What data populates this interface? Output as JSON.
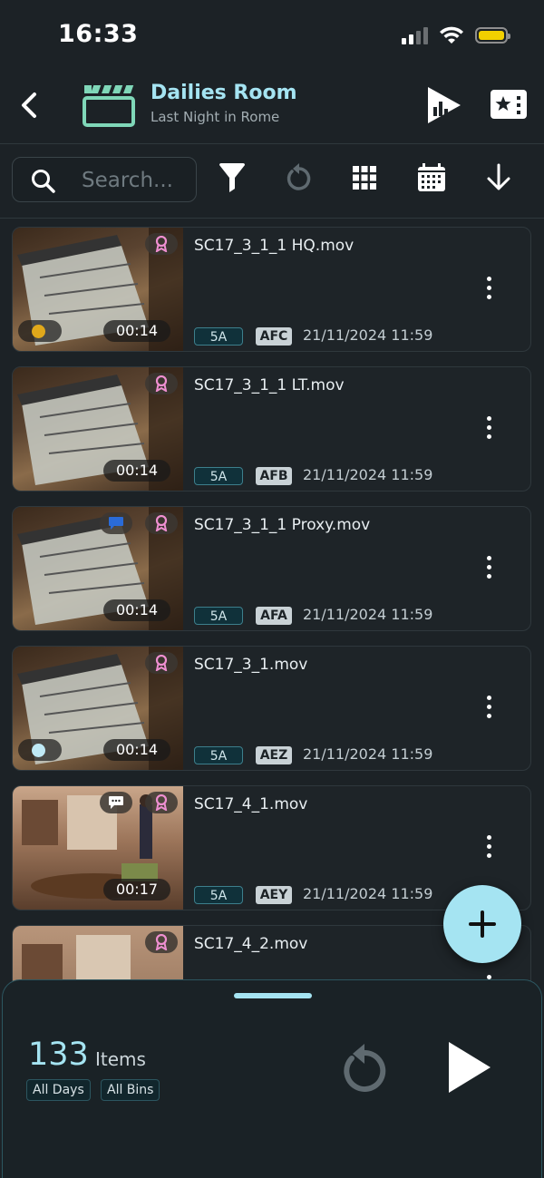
{
  "status_bar": {
    "time": "16:33"
  },
  "header": {
    "title": "Dailies Room",
    "subtitle": "Last Night in Rome"
  },
  "toolbar": {
    "search_placeholder": "Search...",
    "icons": [
      "search-icon",
      "filter-icon",
      "refresh-icon",
      "grid-icon",
      "calendar-icon",
      "sort-down-icon"
    ]
  },
  "clips": [
    {
      "filename": "SC17_3_1_1 HQ.mov",
      "duration": "00:14",
      "scene": "5A",
      "take": "AFC",
      "datetime": "21/11/2024 11:59",
      "status_dot": "#e0a81b",
      "has_comment": false
    },
    {
      "filename": "SC17_3_1_1 LT.mov",
      "duration": "00:14",
      "scene": "5A",
      "take": "AFB",
      "datetime": "21/11/2024 11:59",
      "status_dot": null,
      "has_comment": false
    },
    {
      "filename": "SC17_3_1_1 Proxy.mov",
      "duration": "00:14",
      "scene": "5A",
      "take": "AFA",
      "datetime": "21/11/2024 11:59",
      "status_dot": null,
      "has_comment": true,
      "comment_color": "#2a6bd8"
    },
    {
      "filename": "SC17_3_1.mov",
      "duration": "00:14",
      "scene": "5A",
      "take": "AEZ",
      "datetime": "21/11/2024 11:59",
      "status_dot": "#bfe9f5",
      "has_comment": false
    },
    {
      "filename": "SC17_4_1.mov",
      "duration": "00:17",
      "scene": "5A",
      "take": "AEY",
      "datetime": "21/11/2024 11:59",
      "status_dot": null,
      "has_comment": true,
      "comment_color": "#ffffff"
    },
    {
      "filename": "SC17_4_2.mov",
      "duration": "",
      "scene": "",
      "take": "",
      "datetime": "",
      "status_dot": null,
      "has_comment": false
    }
  ],
  "summary": {
    "count": "133",
    "count_label": "Items",
    "filters": [
      "All Days",
      "All Bins"
    ]
  },
  "colors": {
    "accent": "#a5e4f2",
    "background": "#1c2226",
    "ribbon": "#ef8fd1"
  }
}
